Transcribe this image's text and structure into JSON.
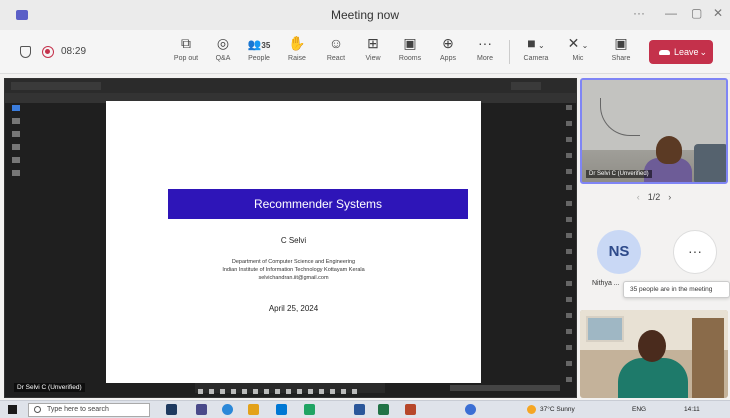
{
  "window": {
    "title": "Meeting now",
    "minimize": "—",
    "restore": "▢",
    "close": "✕",
    "more": "···"
  },
  "toolbar": {
    "timer": "08:29",
    "buttons": [
      {
        "name": "pop-out-button",
        "icon": "⧉",
        "label": "Pop out"
      },
      {
        "name": "qa-button",
        "icon": "◎",
        "label": "Q&A"
      },
      {
        "name": "people-button",
        "icon": "👥",
        "label": "People",
        "count": "35"
      },
      {
        "name": "raise-button",
        "icon": "✋",
        "label": "Raise"
      },
      {
        "name": "react-button",
        "icon": "☺",
        "label": "React"
      },
      {
        "name": "view-button",
        "icon": "⊞",
        "label": "View"
      },
      {
        "name": "rooms-button",
        "icon": "▣",
        "label": "Rooms"
      },
      {
        "name": "apps-button",
        "icon": "⊕",
        "label": "Apps"
      },
      {
        "name": "more-button",
        "icon": "···",
        "label": "More"
      }
    ],
    "devices": [
      {
        "name": "camera-button",
        "icon": "■",
        "label": "Camera"
      },
      {
        "name": "mic-button",
        "icon": "✕",
        "label": "Mic"
      },
      {
        "name": "share-button",
        "icon": "▣",
        "label": "Share"
      }
    ],
    "leave_label": "Leave"
  },
  "slide": {
    "title": "Recommender Systems",
    "author": "C Selvi",
    "affiliation": [
      "Department of Computer Science and Engineering",
      "Indian Institute of Information Technology Kottayam Kerala",
      "selvichandran.iit@gmail.com"
    ],
    "date": "April 25, 2024"
  },
  "presenter_label": "Dr Selvi C (Unverified)",
  "participants": {
    "main_video_label": "Dr Selvi C (Unverified)",
    "page": "1/2",
    "avatar_initials": "NS",
    "avatar_name": "Nithya ...",
    "more": "···",
    "tooltip": "35 people are in the meeting"
  },
  "taskbar": {
    "search_placeholder": "Type here to search",
    "weather": "37°C Sunny",
    "lang": "ENG",
    "time": "14:11"
  },
  "colors": {
    "accent": "#5b5fc7",
    "leave": "#c4314b",
    "slide_title_bg": "#2e15b8"
  }
}
